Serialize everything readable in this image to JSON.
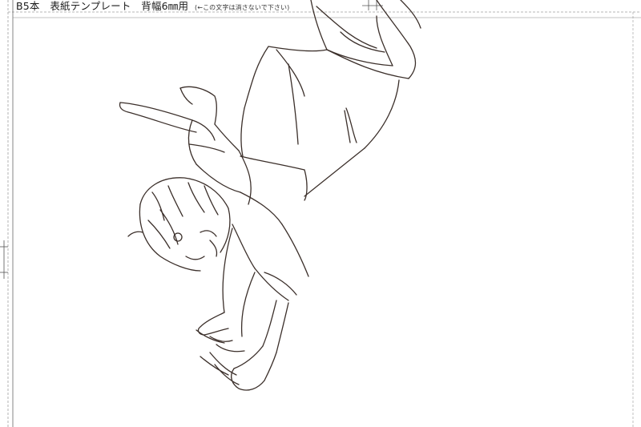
{
  "template": {
    "title": "B5本　表紙テンプレート　背幅6㎜用",
    "note": "(←この文字は消さないで下さい)"
  },
  "colors": {
    "guide": "#9a9a9a",
    "line": "#3b2f2a",
    "background": "#ffffff"
  }
}
